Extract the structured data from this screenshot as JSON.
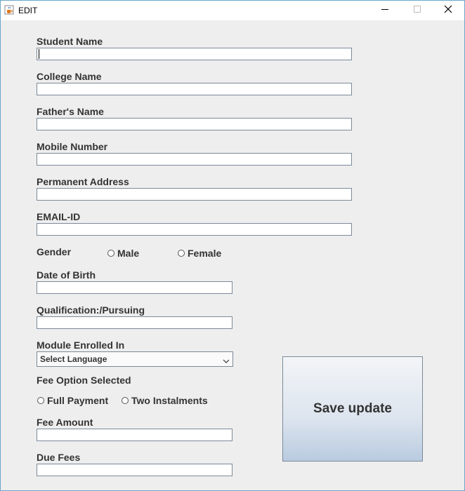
{
  "window": {
    "title": "EDIT"
  },
  "fields": {
    "student_name": {
      "label": "Student Name",
      "value": ""
    },
    "college_name": {
      "label": "College Name",
      "value": ""
    },
    "fathers_name": {
      "label": "Father's Name",
      "value": ""
    },
    "mobile_number": {
      "label": "Mobile Number",
      "value": ""
    },
    "permanent_address": {
      "label": "Permanent Address",
      "value": ""
    },
    "email_id": {
      "label": "EMAIL-ID",
      "value": ""
    },
    "date_of_birth": {
      "label": "Date of Birth",
      "value": ""
    },
    "qualification": {
      "label": "Qualification:/Pursuing",
      "value": ""
    },
    "fee_amount": {
      "label": "Fee Amount",
      "value": ""
    },
    "due_fees": {
      "label": "Due Fees",
      "value": ""
    }
  },
  "gender": {
    "label": "Gender",
    "options": [
      "Male",
      "Female"
    ],
    "selected": null
  },
  "module": {
    "label": "Module Enrolled In",
    "selected": "Select Language"
  },
  "fee_option": {
    "label": "Fee Option Selected",
    "options": [
      "Full Payment",
      "Two Instalments"
    ],
    "selected": null
  },
  "save_button": {
    "label": "Save update"
  },
  "icons": {
    "app": "java-cup-icon",
    "minimize": "minimize-icon",
    "maximize": "maximize-icon",
    "close": "close-icon"
  }
}
